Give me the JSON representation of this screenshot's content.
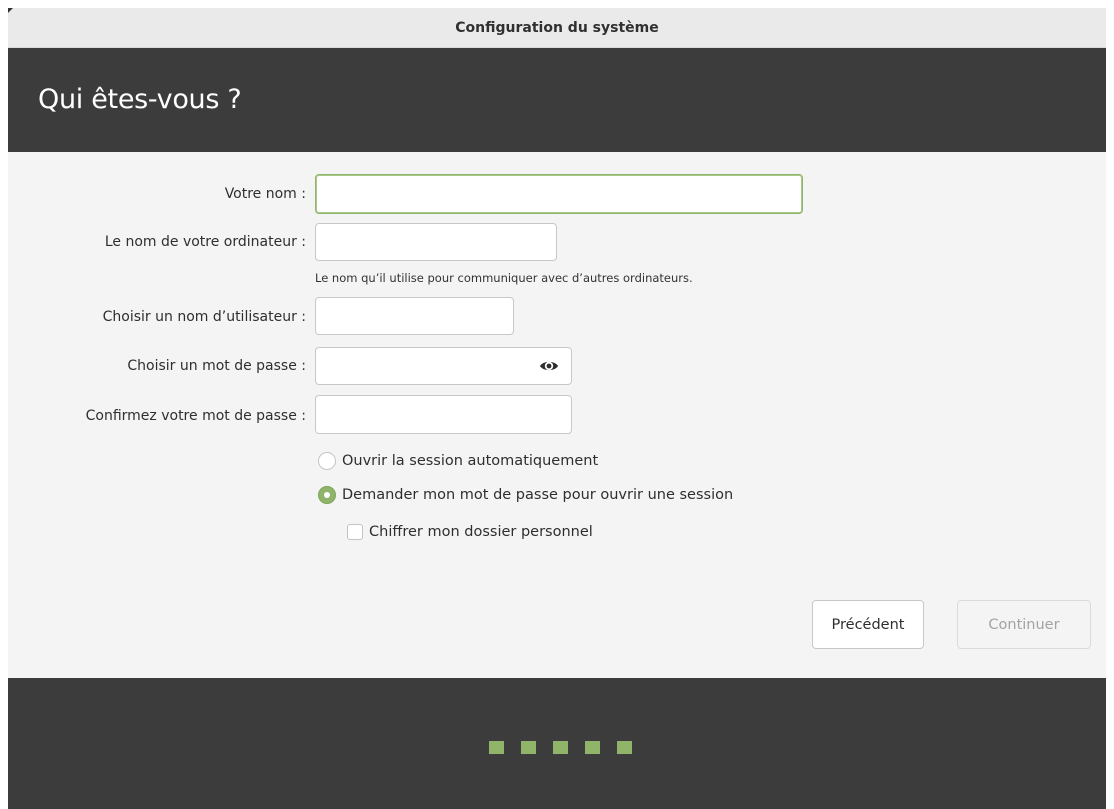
{
  "window": {
    "title": "Configuration du système"
  },
  "header": {
    "title": "Qui êtes-vous ?"
  },
  "form": {
    "name_label": "Votre nom :",
    "name_value": "",
    "computer_label": "Le nom de votre ordinateur :",
    "computer_value": "",
    "computer_hint": "Le nom qu’il utilise pour communiquer avec d’autres ordinateurs.",
    "username_label": "Choisir un nom d’utilisateur :",
    "username_value": "",
    "password_label": "Choisir un mot de passe :",
    "password_value": "",
    "confirm_label": "Confirmez votre mot de passe :",
    "confirm_value": "",
    "password_visibility_icon": "eye-icon"
  },
  "login_options": {
    "auto_login_label": "Ouvrir la session automatiquement",
    "auto_login_selected": false,
    "require_password_label": "Demander mon mot de passe pour ouvrir une session",
    "require_password_selected": true,
    "encrypt_home_label": "Chiffrer mon dossier personnel",
    "encrypt_home_checked": false
  },
  "buttons": {
    "previous_label": "Précédent",
    "continue_label": "Continuer",
    "continue_enabled": false
  },
  "progress": {
    "steps": 5,
    "color": "#8fb46a"
  },
  "colors": {
    "accent": "#8fb46a",
    "header_bg": "#3c3c3c",
    "body_bg": "#f4f4f4"
  }
}
